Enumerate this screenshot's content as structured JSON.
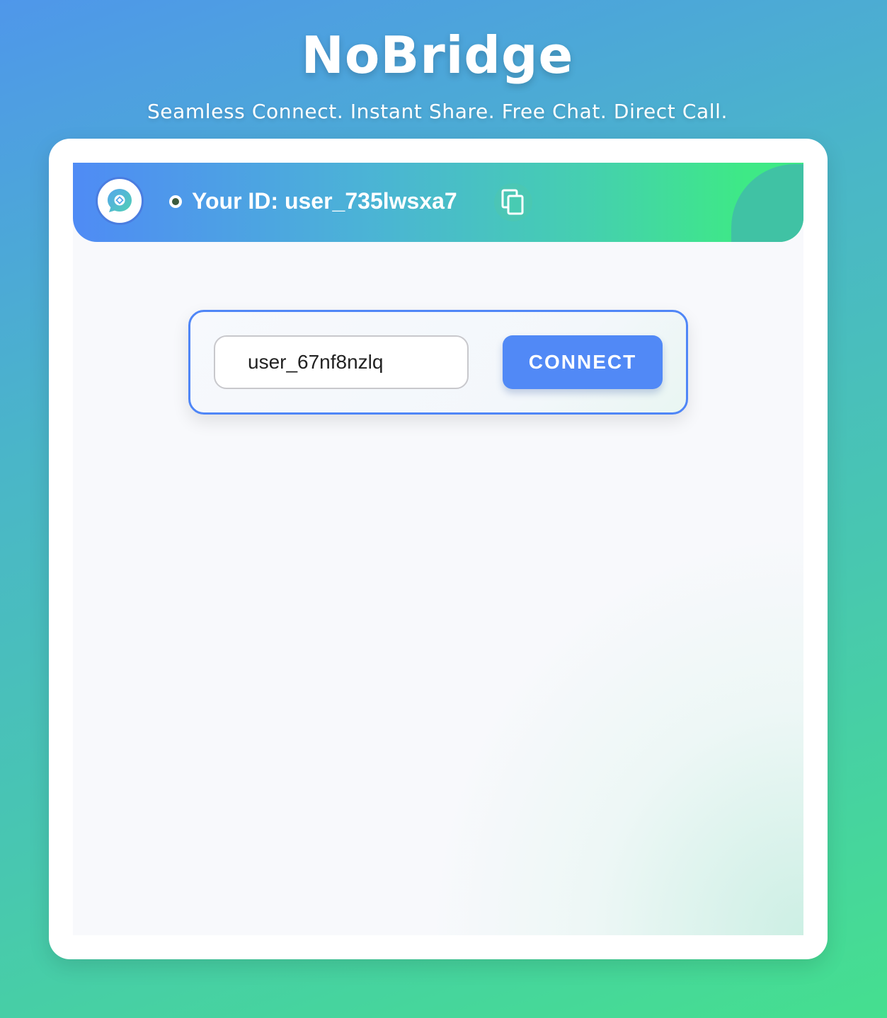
{
  "app": {
    "title": "NoBridge",
    "subtitle": "Seamless Connect. Instant Share. Free Chat. Direct Call."
  },
  "header": {
    "avatar_icon": "chat-bubble-icon",
    "status": "online",
    "your_id_label": "Your ID: user_735lwsxa7",
    "copy_icon": "copy-icon"
  },
  "connect": {
    "peer_id_value": "user_67nf8nzlq",
    "button_label": "CONNECT"
  },
  "colors": {
    "accent": "#5189f6",
    "header_start": "#4f8bf5",
    "header_end": "#3ee986"
  }
}
